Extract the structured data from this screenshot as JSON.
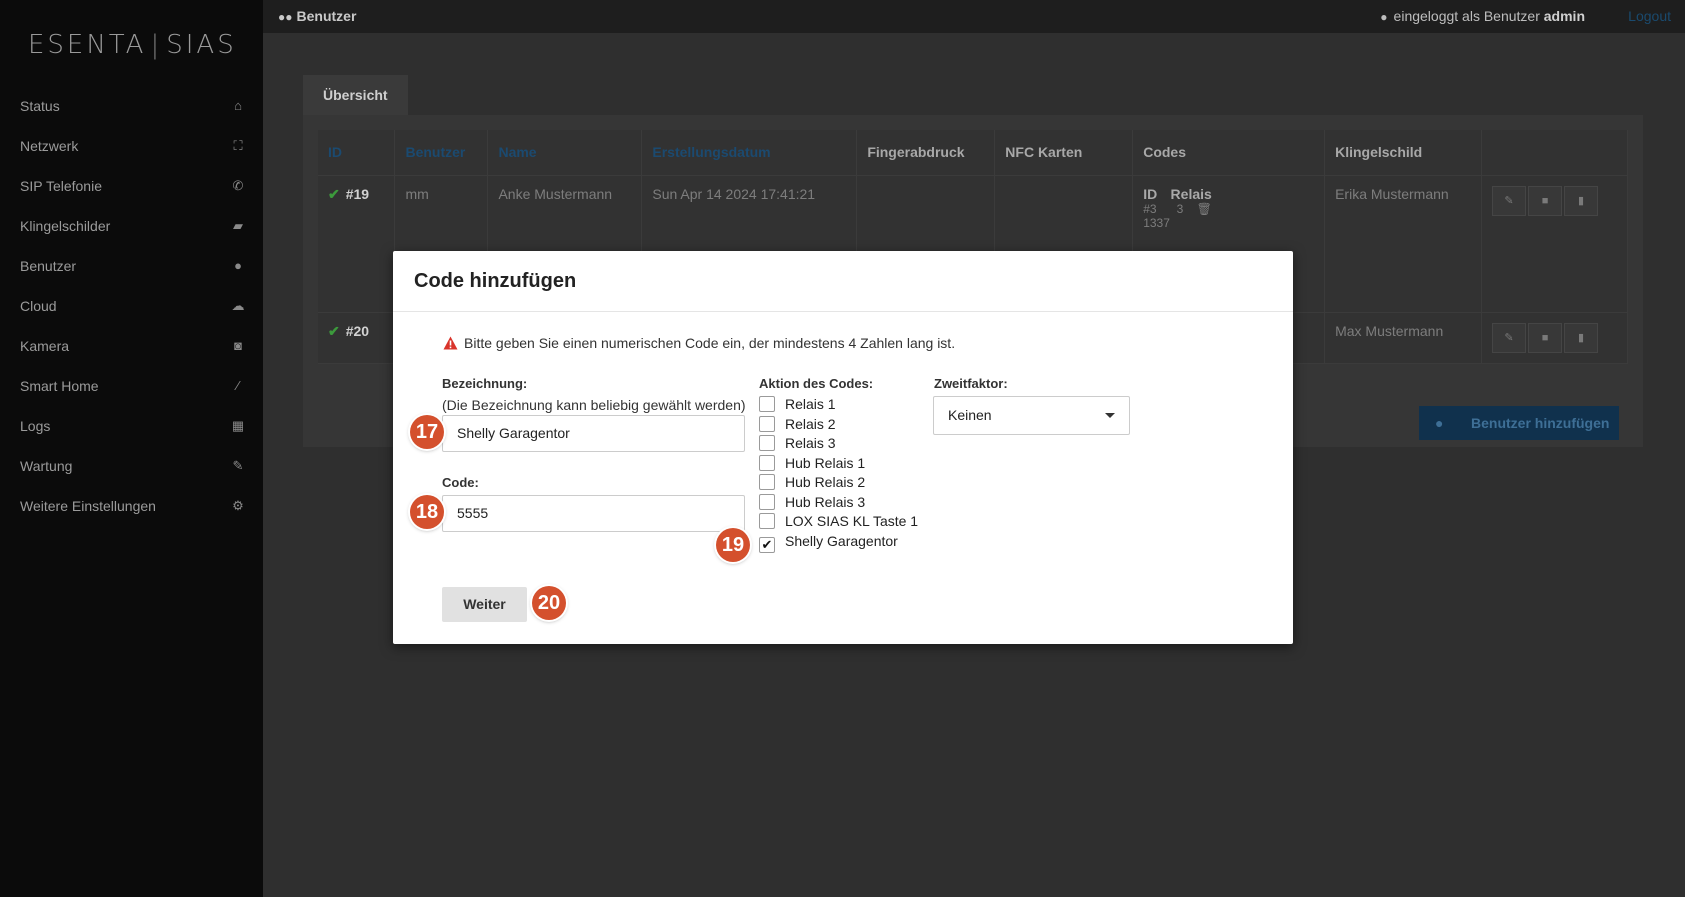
{
  "sidebar": {
    "logo_left": "ESENTA",
    "logo_sep": "|",
    "logo_right": "SIAS",
    "items": [
      {
        "label": "Status",
        "icon": "home-icon"
      },
      {
        "label": "Netzwerk",
        "icon": "sitemap-icon"
      },
      {
        "label": "SIP Telefonie",
        "icon": "phone-icon"
      },
      {
        "label": "Klingelschilder",
        "icon": "book-icon"
      },
      {
        "label": "Benutzer",
        "icon": "users-icon"
      },
      {
        "label": "Cloud",
        "icon": "cloud-icon"
      },
      {
        "label": "Kamera",
        "icon": "camera-icon"
      },
      {
        "label": "Smart Home",
        "icon": "magic-wand-icon"
      },
      {
        "label": "Logs",
        "icon": "calendar-icon"
      },
      {
        "label": "Wartung",
        "icon": "wrench-icon"
      },
      {
        "label": "Weitere Einstellungen",
        "icon": "cogs-icon"
      }
    ]
  },
  "topbar": {
    "page_title": "Benutzer",
    "user_prefix": "eingeloggt als Benutzer",
    "user_name": "admin",
    "logout": "Logout"
  },
  "main": {
    "tab": "Übersicht",
    "table": {
      "headers": [
        "ID",
        "Benutzer",
        "Name",
        "Erstellungsdatum",
        "Fingerabdruck",
        "NFC Karten",
        "Codes",
        "Klingelschild"
      ],
      "rows": [
        {
          "id": "#19",
          "benutzer": "mm",
          "name": "Anke Mustermann",
          "datum": "Sun Apr 14 2024 17:41:21",
          "klingelschild": "Erika Mustermann",
          "codes_id_header": "ID",
          "codes_relais_header": "Relais",
          "code_id": "#3",
          "code_val": "1337",
          "code_relais": "3"
        },
        {
          "id": "#20",
          "benutzer": "",
          "name": "",
          "datum": "",
          "klingelschild": "Max Mustermann"
        }
      ]
    },
    "add_user_button": "Benutzer hinzufügen"
  },
  "modal": {
    "title": "Code hinzufügen",
    "warning": "Bitte geben Sie einen numerischen Code ein, der mindestens 4 Zahlen lang ist.",
    "bezeichnung_label": "Bezeichnung:",
    "bezeichnung_hint": "(Die Bezeichnung kann beliebig gewählt werden)",
    "bezeichnung_value": "Shelly Garagentor",
    "code_label": "Code:",
    "code_value": "5555",
    "aktion_label": "Aktion des Codes:",
    "aktionen": [
      {
        "label": "Relais 1",
        "checked": false
      },
      {
        "label": "Relais 2",
        "checked": false
      },
      {
        "label": "Relais 3",
        "checked": false
      },
      {
        "label": "Hub Relais 1",
        "checked": false
      },
      {
        "label": "Hub Relais 2",
        "checked": false
      },
      {
        "label": "Hub Relais 3",
        "checked": false
      },
      {
        "label": "LOX SIAS KL Taste 1",
        "checked": false
      },
      {
        "label": "Shelly Garagentor",
        "checked": true
      }
    ],
    "zweitfaktor_label": "Zweitfaktor:",
    "zweitfaktor_value": "Keinen",
    "weiter_button": "Weiter"
  },
  "badges": [
    "17",
    "18",
    "19",
    "20"
  ],
  "colors": {
    "badge": "#d4502d",
    "warning_icon": "#d9342b",
    "link_blue": "#1b4a70"
  }
}
